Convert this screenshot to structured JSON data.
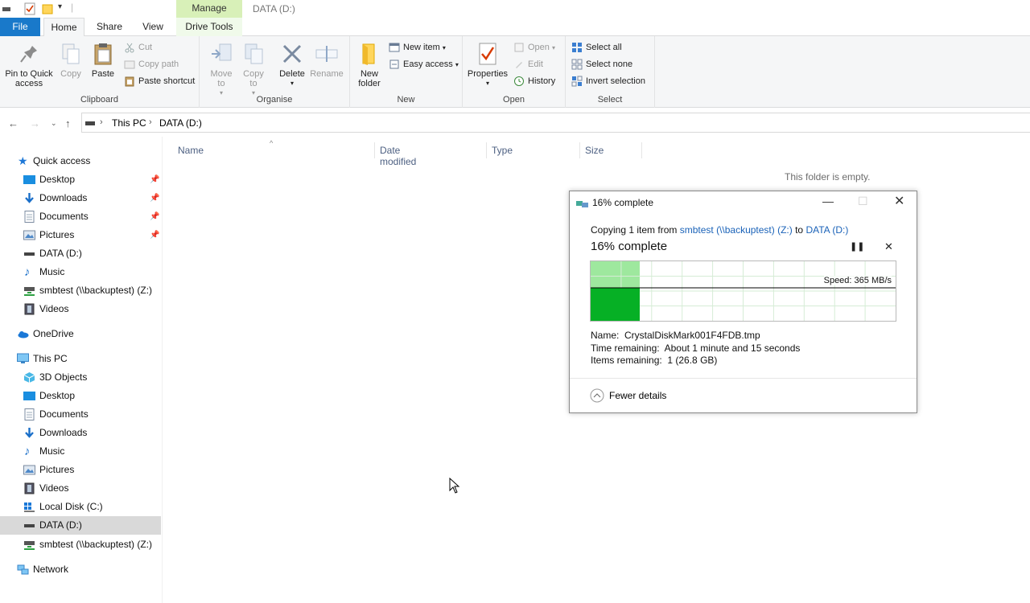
{
  "window": {
    "title": "DATA (D:)",
    "context_group": "Manage"
  },
  "tabs": {
    "file": "File",
    "home": "Home",
    "share": "Share",
    "view": "View",
    "drive_tools": "Drive Tools"
  },
  "ribbon": {
    "clipboard": {
      "label": "Clipboard",
      "pin": "Pin to Quick access",
      "copy": "Copy",
      "paste": "Paste",
      "cut": "Cut",
      "copy_path": "Copy path",
      "paste_shortcut": "Paste shortcut"
    },
    "organise": {
      "label": "Organise",
      "move_to": "Move to",
      "copy_to": "Copy to",
      "delete": "Delete",
      "rename": "Rename"
    },
    "new": {
      "label": "New",
      "new_folder": "New folder",
      "new_item": "New item",
      "easy_access": "Easy access"
    },
    "open": {
      "label": "Open",
      "properties": "Properties",
      "open": "Open",
      "edit": "Edit",
      "history": "History"
    },
    "select": {
      "label": "Select",
      "select_all": "Select all",
      "select_none": "Select none",
      "invert": "Invert selection"
    }
  },
  "address": {
    "crumbs": [
      "This PC",
      "DATA (D:)"
    ]
  },
  "nav": {
    "quick_access": "Quick access",
    "quick_items": [
      {
        "label": "Desktop",
        "pinned": true
      },
      {
        "label": "Downloads",
        "pinned": true
      },
      {
        "label": "Documents",
        "pinned": true
      },
      {
        "label": "Pictures",
        "pinned": true
      },
      {
        "label": "DATA (D:)",
        "pinned": false
      },
      {
        "label": "Music",
        "pinned": false
      },
      {
        "label": "smbtest (\\\\backuptest) (Z:)",
        "pinned": false
      },
      {
        "label": "Videos",
        "pinned": false
      }
    ],
    "onedrive": "OneDrive",
    "this_pc": "This PC",
    "pc_items": [
      "3D Objects",
      "Desktop",
      "Documents",
      "Downloads",
      "Music",
      "Pictures",
      "Videos",
      "Local Disk (C:)",
      "DATA (D:)",
      "smbtest (\\\\backuptest) (Z:)"
    ],
    "network": "Network"
  },
  "columns": {
    "name": "Name",
    "date": "Date modified",
    "type": "Type",
    "size": "Size"
  },
  "empty_text": "This folder is empty.",
  "dialog": {
    "title": "16% complete",
    "copying_prefix": "Copying 1 item from ",
    "source": "smbtest (\\\\backuptest) (Z:)",
    "to_word": " to ",
    "dest": "DATA (D:)",
    "big_status": "16% complete",
    "progress_percent": 16,
    "speed": "Speed: 365 MB/s",
    "name_label": "Name:",
    "name_value": "CrystalDiskMark001F4FDB.tmp",
    "time_label": "Time remaining:",
    "time_value": "About 1 minute and 15 seconds",
    "items_label": "Items remaining:",
    "items_value": "1 (26.8 GB)",
    "fewer_details": "Fewer details"
  },
  "colors": {
    "file_tab": "#1979ca",
    "context_tab": "#d8f0b8",
    "progress_light": "#9ee89e",
    "progress_dark": "#06b025"
  }
}
